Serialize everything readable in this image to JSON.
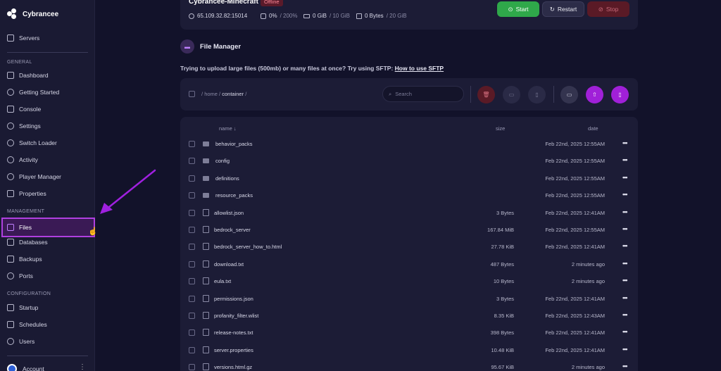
{
  "brand": {
    "name": "Cybrancee"
  },
  "sidebar": {
    "top": {
      "label": "Servers"
    },
    "sections": {
      "general": "GENERAL",
      "management": "MANAGEMENT",
      "configuration": "CONFIGURATION"
    },
    "general_items": [
      "Dashboard",
      "Getting Started",
      "Console",
      "Settings",
      "Switch Loader",
      "Activity",
      "Player Manager",
      "Properties"
    ],
    "management_items": [
      "Files",
      "Databases",
      "Backups",
      "Ports"
    ],
    "configuration_items": [
      "Startup",
      "Schedules",
      "Users"
    ],
    "account": {
      "label": "Account"
    }
  },
  "server": {
    "name": "Cybrancee-Minecraft",
    "status": "Offline",
    "address": "65.109.32.82:15014",
    "cpu_value": "0%",
    "cpu_limit": "/ 200%",
    "memory_value": "0 GiB",
    "memory_limit": "/ 10 GiB",
    "disk_value": "0 Bytes",
    "disk_limit": "/ 20 GiB"
  },
  "controls": {
    "start": "Start",
    "restart": "Restart",
    "stop": "Stop"
  },
  "file_manager": {
    "title": "File Manager",
    "sftp_note": "Trying to upload large files (500mb) or many files at once? Try using SFTP: ",
    "sftp_link": "How to use SFTP",
    "breadcrumb": {
      "sep": "/",
      "home": "home",
      "container": "container"
    },
    "search_placeholder": "Search",
    "columns": {
      "name": "name ↓",
      "size": "size",
      "date": "date"
    },
    "files": [
      {
        "name": "behavior_packs",
        "type": "folder",
        "size": "",
        "date": "Feb 22nd, 2025 12:55AM"
      },
      {
        "name": "config",
        "type": "folder",
        "size": "",
        "date": "Feb 22nd, 2025 12:55AM"
      },
      {
        "name": "definitions",
        "type": "folder",
        "size": "",
        "date": "Feb 22nd, 2025 12:55AM"
      },
      {
        "name": "resource_packs",
        "type": "folder",
        "size": "",
        "date": "Feb 22nd, 2025 12:55AM"
      },
      {
        "name": "allowlist.json",
        "type": "file",
        "size": "3 Bytes",
        "date": "Feb 22nd, 2025 12:41AM"
      },
      {
        "name": "bedrock_server",
        "type": "file",
        "size": "167.84 MiB",
        "date": "Feb 22nd, 2025 12:55AM"
      },
      {
        "name": "bedrock_server_how_to.html",
        "type": "file",
        "size": "27.78 KiB",
        "date": "Feb 22nd, 2025 12:41AM"
      },
      {
        "name": "download.txt",
        "type": "file",
        "size": "487 Bytes",
        "date": "2 minutes ago"
      },
      {
        "name": "eula.txt",
        "type": "file",
        "size": "10 Bytes",
        "date": "2 minutes ago"
      },
      {
        "name": "permissions.json",
        "type": "file",
        "size": "3 Bytes",
        "date": "Feb 22nd, 2025 12:41AM"
      },
      {
        "name": "profanity_filter.wlist",
        "type": "file",
        "size": "8.35 KiB",
        "date": "Feb 22nd, 2025 12:43AM"
      },
      {
        "name": "release-notes.txt",
        "type": "file",
        "size": "398 Bytes",
        "date": "Feb 22nd, 2025 12:41AM"
      },
      {
        "name": "server.properties",
        "type": "file",
        "size": "10.48 KiB",
        "date": "Feb 22nd, 2025 12:41AM"
      },
      {
        "name": "versions.html.gz",
        "type": "file",
        "size": "95.67 KiB",
        "date": "2 minutes ago"
      }
    ],
    "row_menu": "•••"
  },
  "colors": {
    "accent": "#b040e0",
    "start": "#2fa84a",
    "stop": "#5a1a26",
    "background": "#12122a",
    "card": "#1c1c36"
  }
}
